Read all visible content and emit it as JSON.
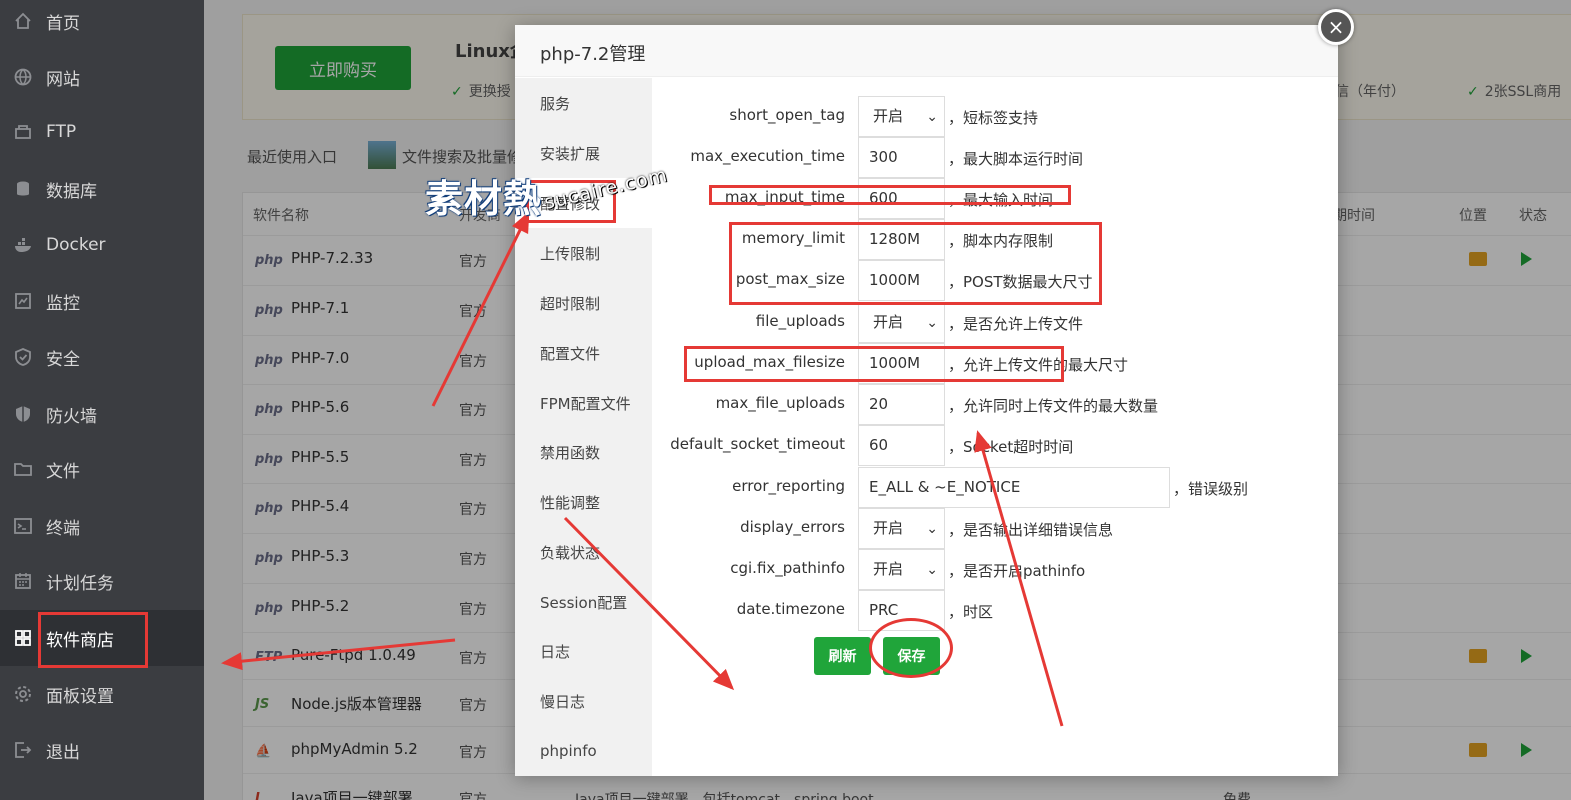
{
  "sidebar": {
    "items": [
      {
        "label": "首页",
        "icon": "home-icon"
      },
      {
        "label": "网站",
        "icon": "globe-icon"
      },
      {
        "label": "FTP",
        "icon": "ftp-icon"
      },
      {
        "label": "数据库",
        "icon": "database-icon"
      },
      {
        "label": "Docker",
        "icon": "docker-icon"
      },
      {
        "label": "监控",
        "icon": "monitor-icon"
      },
      {
        "label": "安全",
        "icon": "shield-check-icon"
      },
      {
        "label": "防火墙",
        "icon": "firewall-icon"
      },
      {
        "label": "文件",
        "icon": "folder-icon"
      },
      {
        "label": "终端",
        "icon": "terminal-icon"
      },
      {
        "label": "计划任务",
        "icon": "calendar-icon"
      },
      {
        "label": "软件商店",
        "icon": "grid-icon"
      },
      {
        "label": "面板设置",
        "icon": "gear-icon"
      },
      {
        "label": "退出",
        "icon": "logout-icon"
      }
    ],
    "active_index": 11
  },
  "promo": {
    "buy_label": "立即购买",
    "title": "Linux企",
    "feature_1": "更换授",
    "feature_2": "短信（年付）",
    "feature_3": "2张SSL商用"
  },
  "recent": {
    "label": "最近使用入口",
    "item": "文件搜索及批量修"
  },
  "table": {
    "headers": {
      "name": "软件名称",
      "developer": "开发商",
      "expire": "期时间",
      "location": "位置",
      "status": "状态"
    },
    "rows": [
      {
        "logo": "php",
        "name": "PHP-7.2.33",
        "dev": "官方",
        "actions": true
      },
      {
        "logo": "php",
        "name": "PHP-7.1",
        "dev": "官方",
        "actions": false
      },
      {
        "logo": "php",
        "name": "PHP-7.0",
        "dev": "官方",
        "actions": false
      },
      {
        "logo": "php",
        "name": "PHP-5.6",
        "dev": "官方",
        "actions": false
      },
      {
        "logo": "php",
        "name": "PHP-5.5",
        "dev": "官方",
        "actions": false
      },
      {
        "logo": "php",
        "name": "PHP-5.4",
        "dev": "官方",
        "actions": false
      },
      {
        "logo": "php",
        "name": "PHP-5.3",
        "dev": "官方",
        "actions": false
      },
      {
        "logo": "php",
        "name": "PHP-5.2",
        "dev": "官方",
        "actions": false
      },
      {
        "logo": "FTP",
        "name": "Pure-Ftpd 1.0.49",
        "dev": "官方",
        "actions": true
      },
      {
        "logo": "JS",
        "name": "Node.js版本管理器",
        "dev": "官方",
        "actions": false
      },
      {
        "logo": "⛵",
        "name": "phpMyAdmin 5.2",
        "dev": "官方",
        "actions": true
      },
      {
        "logo": "J",
        "name": "Java项目一键部署",
        "dev": "官方",
        "actions": false
      }
    ],
    "last_row_desc": "Java项目一键部署，包括tomcat，spring boot",
    "last_row_price": "免费"
  },
  "modal": {
    "title": "php-7.2管理",
    "close_label": "×",
    "side_items": [
      "服务",
      "安装扩展",
      "配置修改",
      "上传限制",
      "超时限制",
      "配置文件",
      "FPM配置文件",
      "禁用函数",
      "性能调整",
      "负载状态",
      "Session配置",
      "日志",
      "慢日志",
      "phpinfo"
    ],
    "side_active": 2,
    "fields": [
      {
        "label": "short_open_tag",
        "type": "select",
        "value": "开启",
        "desc": "，短标签支持"
      },
      {
        "label": "max_execution_time",
        "type": "input",
        "value": "300",
        "desc": "，最大脚本运行时间"
      },
      {
        "label": "max_input_time",
        "type": "input",
        "value": "600",
        "desc": "，最大输入时间"
      },
      {
        "label": "memory_limit",
        "type": "input",
        "value": "1280M",
        "desc": "，脚本内存限制"
      },
      {
        "label": "post_max_size",
        "type": "input",
        "value": "1000M",
        "desc": "，POST数据最大尺寸"
      },
      {
        "label": "file_uploads",
        "type": "select",
        "value": "开启",
        "desc": "，是否允许上传文件"
      },
      {
        "label": "upload_max_filesize",
        "type": "input",
        "value": "1000M",
        "desc": "，允许上传文件的最大尺寸"
      },
      {
        "label": "max_file_uploads",
        "type": "input",
        "value": "20",
        "desc": "，允许同时上传文件的最大数量"
      },
      {
        "label": "default_socket_timeout",
        "type": "input",
        "value": "60",
        "desc": "，Socket超时时间"
      },
      {
        "label": "error_reporting",
        "type": "wide",
        "value": "E_ALL & ~E_NOTICE",
        "desc": "，错误级别"
      },
      {
        "label": "display_errors",
        "type": "select",
        "value": "开启",
        "desc": "，是否输出详细错误信息"
      },
      {
        "label": "cgi.fix_pathinfo",
        "type": "select",
        "value": "开启",
        "desc": "，是否开启pathinfo"
      },
      {
        "label": "date.timezone",
        "type": "input",
        "value": "PRC",
        "desc": "，时区"
      }
    ],
    "refresh_label": "刷新",
    "save_label": "保存"
  },
  "watermark": {
    "main": "素材熱",
    "sub": "sucaire.com"
  },
  "colors": {
    "sidebar_bg": "#3b3d41",
    "accent_green": "#20a53a",
    "annotation_red": "#e53935"
  }
}
